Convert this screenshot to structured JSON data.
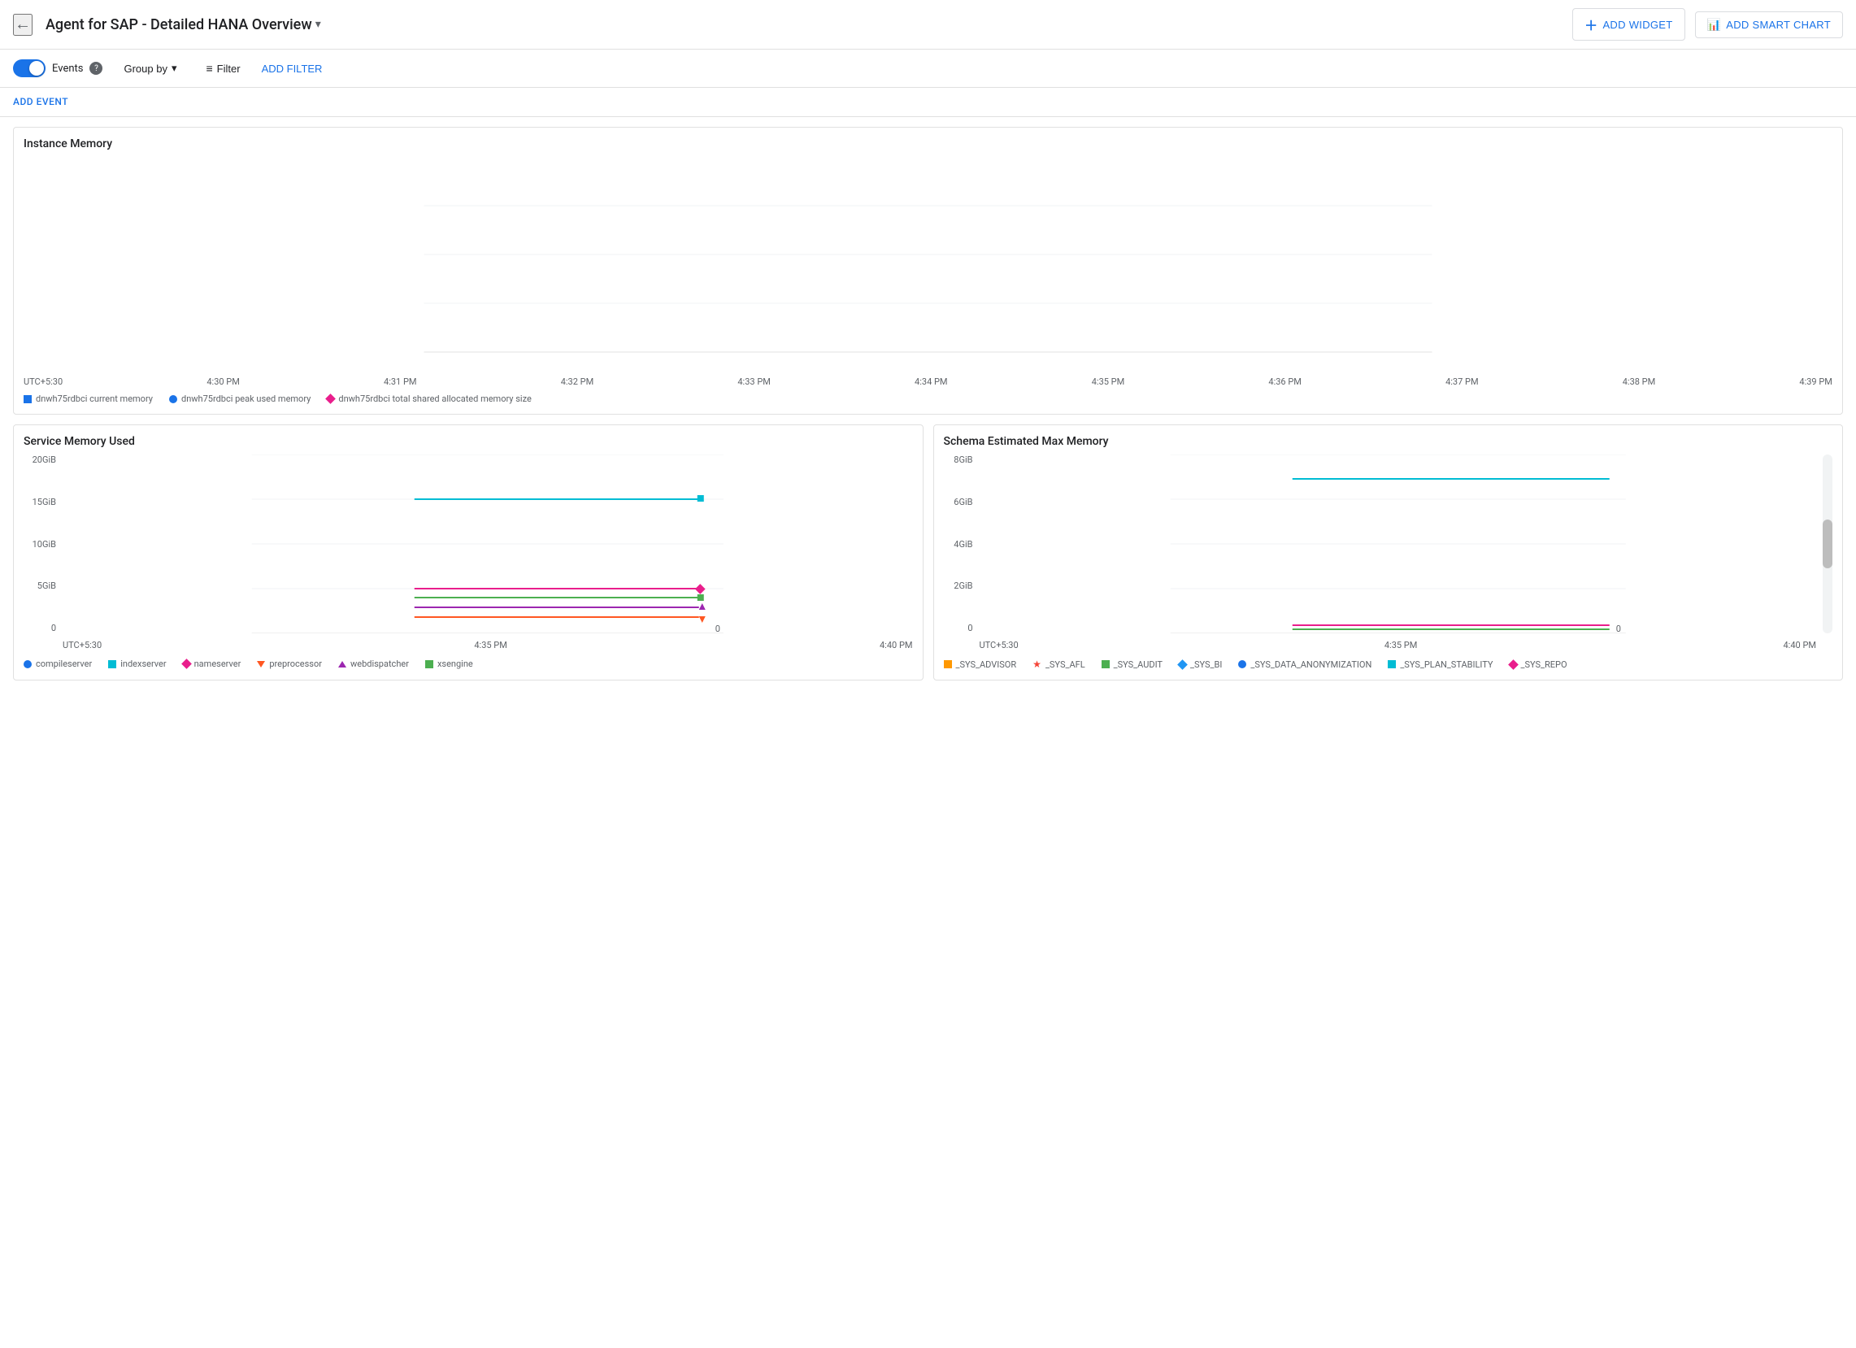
{
  "header": {
    "back_label": "←",
    "title": "Agent for SAP - Detailed HANA Overview",
    "title_dropdown_icon": "▾",
    "add_widget_label": "ADD WIDGET",
    "add_smart_chart_label": "ADD SMART CHART"
  },
  "toolbar": {
    "events_label": "Events",
    "group_by_label": "Group by",
    "filter_label": "Filter",
    "add_filter_label": "ADD FILTER"
  },
  "add_event": {
    "label": "ADD EVENT"
  },
  "instance_memory": {
    "title": "Instance Memory",
    "time_labels": [
      "UTC+5:30",
      "4:30 PM",
      "4:31 PM",
      "4:32 PM",
      "4:33 PM",
      "4:34 PM",
      "4:35 PM",
      "4:36 PM",
      "4:37 PM",
      "4:38 PM",
      "4:39 PM"
    ],
    "legend": [
      {
        "type": "square",
        "color": "#1a73e8",
        "label": "dnwh75rdbci current memory"
      },
      {
        "type": "circle",
        "color": "#1a73e8",
        "label": "dnwh75rdbci peak used memory"
      },
      {
        "type": "diamond",
        "color": "#e91e8c",
        "label": "dnwh75rdbci total shared allocated memory size"
      }
    ]
  },
  "service_memory": {
    "title": "Service Memory Used",
    "y_labels": [
      "20GiB",
      "15GiB",
      "10GiB",
      "5GiB",
      "0"
    ],
    "time_labels": [
      "UTC+5:30",
      "4:35 PM",
      "4:40 PM"
    ],
    "legend": [
      {
        "type": "circle",
        "color": "#1a73e8",
        "label": "compileserver"
      },
      {
        "type": "square",
        "color": "#00bcd4",
        "label": "indexserver"
      },
      {
        "type": "diamond",
        "color": "#e91e8c",
        "label": "nameserver"
      },
      {
        "type": "triangle-down",
        "color": "#ff5722",
        "label": "preprocessor"
      },
      {
        "type": "triangle-up",
        "color": "#9c27b0",
        "label": "webdispatcher"
      },
      {
        "type": "square",
        "color": "#4caf50",
        "label": "xsengine"
      }
    ],
    "series": [
      {
        "color": "#00bcd4",
        "y_pct": 75,
        "type": "line"
      },
      {
        "color": "#e91e8c",
        "y_pct": 25,
        "type": "line"
      },
      {
        "color": "#4caf50",
        "y_pct": 20,
        "type": "line"
      },
      {
        "color": "#9c27b0",
        "y_pct": 15,
        "type": "line"
      },
      {
        "color": "#ff5722",
        "y_pct": 5,
        "type": "line"
      }
    ]
  },
  "schema_memory": {
    "title": "Schema Estimated Max Memory",
    "y_labels": [
      "8GiB",
      "6GiB",
      "4GiB",
      "2GiB",
      "0"
    ],
    "time_labels": [
      "UTC+5:30",
      "4:35 PM",
      "4:40 PM"
    ],
    "legend": [
      {
        "type": "square",
        "color": "#ff9800",
        "label": "_SYS_ADVISOR"
      },
      {
        "type": "star",
        "color": "#f44336",
        "label": "_SYS_AFL"
      },
      {
        "type": "square",
        "color": "#4caf50",
        "label": "_SYS_AUDIT"
      },
      {
        "type": "diamond",
        "color": "#2196f3",
        "label": "_SYS_BI"
      },
      {
        "type": "circle",
        "color": "#1a73e8",
        "label": "_SYS_DATA_ANONYMIZATION"
      },
      {
        "type": "square",
        "color": "#00bcd4",
        "label": "_SYS_PLAN_STABILITY"
      },
      {
        "type": "diamond",
        "color": "#e91e8c",
        "label": "_SYS_REPO"
      }
    ],
    "series": [
      {
        "color": "#00bcd4",
        "y_pct": 80,
        "type": "line"
      },
      {
        "color": "#e91e8c",
        "y_pct": 5,
        "type": "line"
      },
      {
        "color": "#4caf50",
        "y_pct": 3,
        "type": "line"
      }
    ]
  }
}
